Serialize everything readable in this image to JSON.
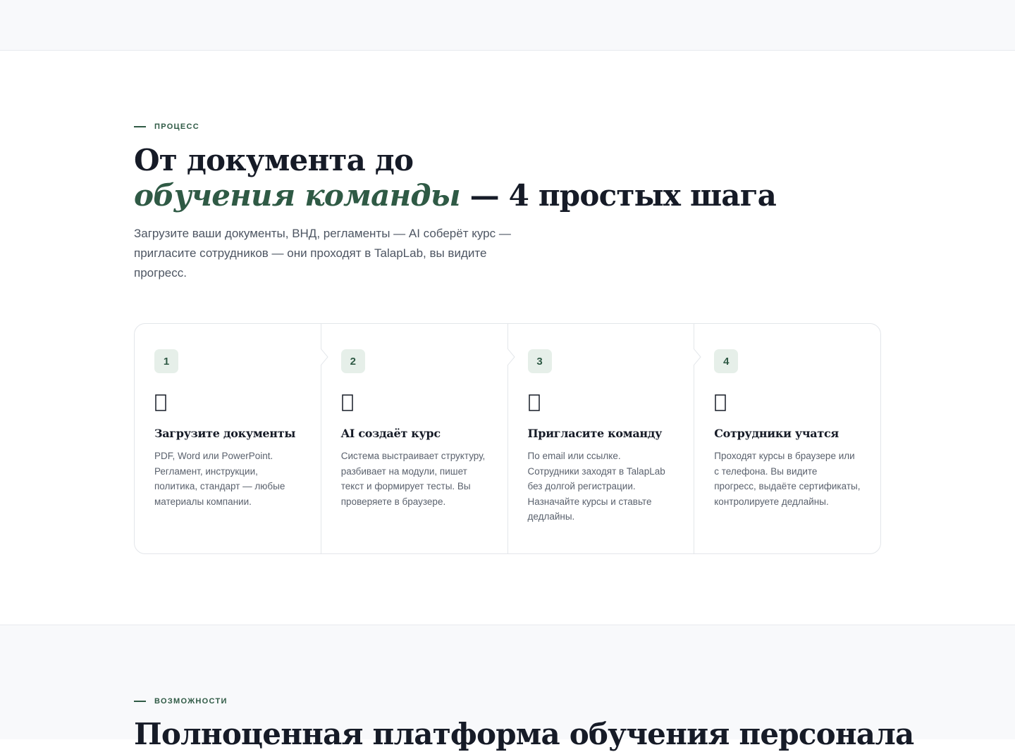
{
  "process": {
    "eyebrow": "ПРОЦЕСС",
    "title_line1": "От документа до",
    "title_accent": "обучения команды",
    "title_rest": " — 4 простых шага",
    "lead": "Загрузите ваши документы, ВНД, регламенты — AI соберёт курс — пригласите сотрудников — они проходят в TalapLab, вы видите прогресс.",
    "steps": [
      {
        "number": "1",
        "icon": "upload-document-icon",
        "title": "Загрузите документы",
        "text": "PDF, Word или PowerPoint. Регламент, инструкции, политика, стандарт — любые материалы компании."
      },
      {
        "number": "2",
        "icon": "ai-sparkle-icon",
        "title": "AI создаёт курс",
        "text": "Система выстраивает структуру, разбивает на модули, пишет текст и формирует тесты. Вы проверяете в браузере."
      },
      {
        "number": "3",
        "icon": "team-invite-icon",
        "title": "Пригласите команду",
        "text": "По email или ссылке. Сотрудники заходят в TalapLab без долгой регистрации. Назначайте курсы и ставьте дедлайны."
      },
      {
        "number": "4",
        "icon": "learning-progress-icon",
        "title": "Сотрудники учатся",
        "text": "Проходят курсы в браузере или с телефона. Вы видите прогресс, выдаёте сертификаты, контролируете дедлайны."
      }
    ]
  },
  "features": {
    "eyebrow": "ВОЗМОЖНОСТИ",
    "title": "Полноценная платформа обучения персонала"
  },
  "colors": {
    "accent": "#2f5a45",
    "badge_bg": "#e6efe9",
    "heading": "#161b27",
    "body_text": "#4d5562",
    "band_bg": "#f8f9fb",
    "border": "#e3e6ea"
  }
}
